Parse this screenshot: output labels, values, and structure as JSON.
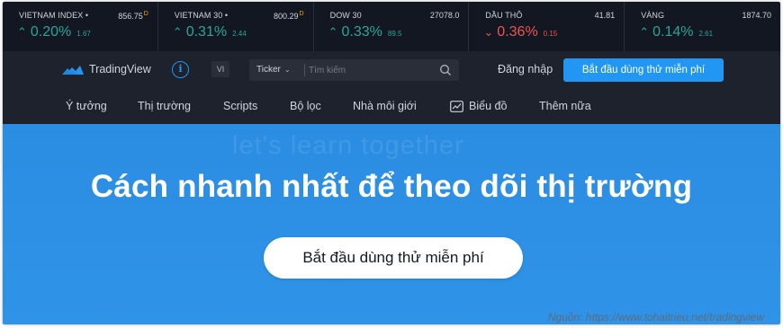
{
  "tickers": [
    {
      "name": "VIETNAM INDEX",
      "dot": "•",
      "price": "856.75",
      "flag": "D",
      "direction": "up",
      "arrow": "^",
      "change_pct": "0.20%",
      "change_abs": "1.67"
    },
    {
      "name": "VIETNAM 30",
      "dot": "•",
      "price": "800.29",
      "flag": "D",
      "direction": "up",
      "arrow": "^",
      "change_pct": "0.31%",
      "change_abs": "2.44"
    },
    {
      "name": "DOW 30",
      "dot": "",
      "price": "27078.0",
      "flag": "",
      "direction": "up",
      "arrow": "^",
      "change_pct": "0.33%",
      "change_abs": "89.5"
    },
    {
      "name": "DẦU THÔ",
      "dot": "",
      "price": "41.81",
      "flag": "",
      "direction": "down",
      "arrow": "v",
      "change_pct": "0.36%",
      "change_abs": "0.15"
    },
    {
      "name": "VÀNG",
      "dot": "",
      "price": "1874.70",
      "flag": "",
      "direction": "up",
      "arrow": "^",
      "change_pct": "0.14%",
      "change_abs": "2.61"
    }
  ],
  "header": {
    "brand": "TradingView",
    "info_icon": "i",
    "lang": "VI",
    "search_type": "Ticker",
    "search_placeholder": "Tìm kiếm",
    "login": "Đăng nhập",
    "cta": "Bắt đầu dùng thử miễn phí"
  },
  "nav": {
    "items": [
      "Ý tưởng",
      "Thị trường",
      "Scripts",
      "Bộ lọc",
      "Nhà môi giới",
      "Biểu đồ",
      "Thêm nữa"
    ]
  },
  "hero": {
    "watermark": "let's learn together",
    "title": "Cách nhanh nhất để theo dõi thị trường",
    "button": "Bắt đầu dùng thử miễn phí"
  },
  "source": "Nguồn: https://www.tohaitrieu.net/tradingview",
  "colors": {
    "up": "#26a69a",
    "down": "#ef5350",
    "accent": "#2196f3",
    "hero": "#2f93e8",
    "dark": "#131722"
  }
}
